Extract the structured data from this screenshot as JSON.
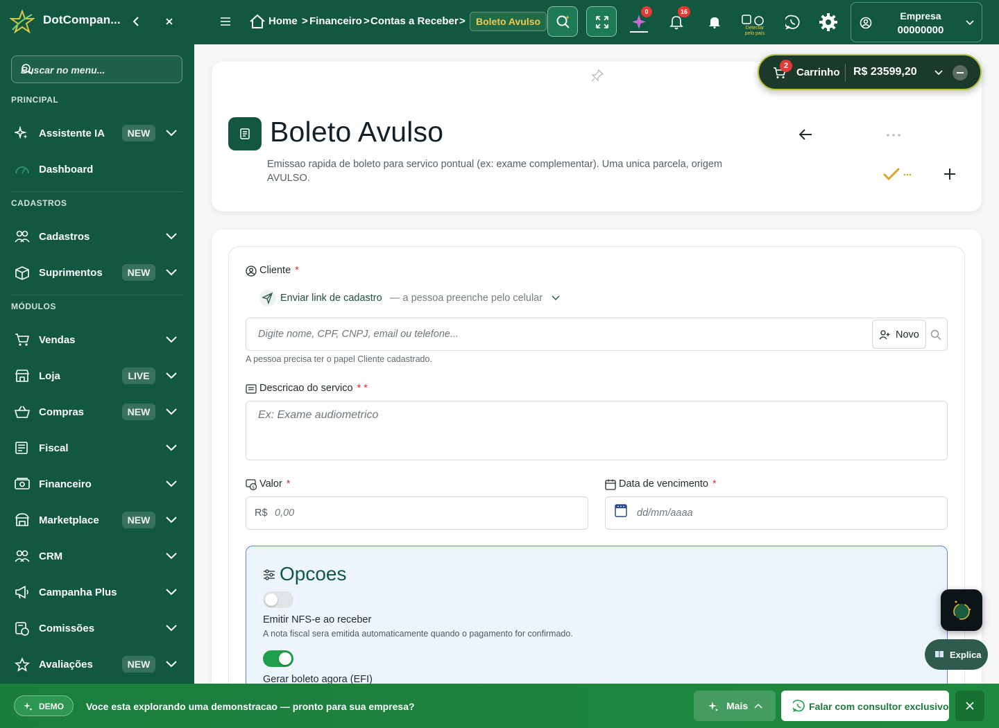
{
  "brand": {
    "name": "DotCompan..."
  },
  "sidebar": {
    "search_placeholder": "Buscar no menu...",
    "sections": {
      "principal": "PRINCIPAL",
      "cadastros": "CADASTROS",
      "modulos": "MÓDULOS"
    },
    "items": [
      {
        "label": "Assistente IA",
        "badge": "NEW",
        "icon": "sparkles-icon"
      },
      {
        "label": "Dashboard",
        "badge": "",
        "icon": "gauge-icon"
      },
      {
        "label": "Cadastros",
        "badge": "",
        "icon": "users-icon"
      },
      {
        "label": "Suprimentos",
        "badge": "NEW",
        "icon": "box-icon"
      },
      {
        "label": "Vendas",
        "badge": "",
        "icon": "cart-icon"
      },
      {
        "label": "Loja",
        "badge": "LIVE",
        "icon": "store-icon"
      },
      {
        "label": "Compras",
        "badge": "NEW",
        "icon": "basket-icon"
      },
      {
        "label": "Fiscal",
        "badge": "",
        "icon": "document-icon"
      },
      {
        "label": "Financeiro",
        "badge": "",
        "icon": "cash-icon"
      },
      {
        "label": "Marketplace",
        "badge": "NEW",
        "icon": "shop-icon"
      },
      {
        "label": "CRM",
        "badge": "",
        "icon": "users-icon"
      },
      {
        "label": "Campanha Plus",
        "badge": "",
        "icon": "megaphone-icon"
      },
      {
        "label": "Comissões",
        "badge": "",
        "icon": "coins-icon"
      },
      {
        "label": "Avaliações",
        "badge": "NEW",
        "icon": "star-icon"
      }
    ]
  },
  "topbar": {
    "breadcrumb": [
      "Home",
      "Financeiro",
      "Contas a Receber",
      "Boleto Avulso"
    ],
    "ai_count": "0",
    "notif_count": "16",
    "translate_label": "Detectar pelo país",
    "empresa_label": "Empresa",
    "empresa_code": "00000000"
  },
  "cart": {
    "label": "Carrinho",
    "count": "2",
    "amount": "R$ 23599,20"
  },
  "page": {
    "title": "Boleto Avulso",
    "subtitle": "Emissao rapida de boleto para servico pontual (ex: exame complementar). Uma unica parcela, origem AVULSO."
  },
  "form": {
    "cliente_label": "Cliente",
    "enviar_link": "Enviar link de cadastro",
    "enviar_link_hint": "— a pessoa preenche pelo celular",
    "cliente_placeholder": "Digite nome, CPF, CNPJ, email ou telefone...",
    "novo_label": "Novo",
    "cliente_help": "A pessoa precisa ter o papel Cliente cadastrado.",
    "descricao_label": "Descricao do servico",
    "descricao_placeholder": "Ex: Exame audiometrico",
    "valor_label": "Valor",
    "valor_prefix": "R$",
    "valor_placeholder": "0,00",
    "data_label": "Data de vencimento",
    "data_placeholder": "dd/mm/aaaa",
    "req_mark": "*",
    "req_mark_double": "* *"
  },
  "opcoes": {
    "title": "Opcoes",
    "nfse_label": "Emitir NFS-e ao receber",
    "nfse_help": "A nota fiscal sera emitida automaticamente quando o pagamento for confirmado.",
    "nfse_on": false,
    "boleto_label": "Gerar boleto agora (EFI)",
    "boleto_on": true
  },
  "explica": {
    "label": "Explica"
  },
  "demo": {
    "badge": "DEMO",
    "text": "Voce esta explorando uma demonstracao — pronto para sua empresa?",
    "mais": "Mais",
    "falar": "Falar com consultor exclusivo"
  },
  "colors": {
    "brand_green": "#12573f",
    "accent_gold": "#f2c94c",
    "demo_green": "#1e8a3f"
  }
}
